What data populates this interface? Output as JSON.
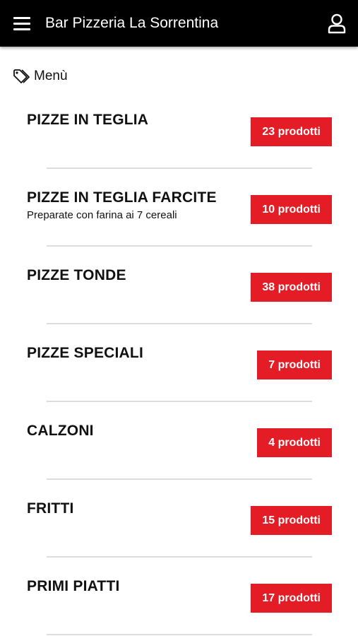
{
  "header": {
    "title": "Bar Pizzeria La Sorrentina",
    "menu_icon": "hamburger-menu-icon",
    "account_icon": "user-account-icon",
    "background": "#000000"
  },
  "section": {
    "icon": "tag-icon",
    "label": "Menù"
  },
  "accent_color": "#e31c25",
  "categories": [
    {
      "name": "PIZZE IN TEGLIA",
      "subtitle": "",
      "count": "23 prodotti"
    },
    {
      "name": "PIZZE IN TEGLIA FARCITE",
      "subtitle": "Preparate con farina ai 7 cereali",
      "count": "10 prodotti"
    },
    {
      "name": "PIZZE TONDE",
      "subtitle": "",
      "count": "38 prodotti"
    },
    {
      "name": "PIZZE SPECIALI",
      "subtitle": "",
      "count": "7 prodotti"
    },
    {
      "name": "CALZONI",
      "subtitle": "",
      "count": "4 prodotti"
    },
    {
      "name": "FRITTI",
      "subtitle": "",
      "count": "15 prodotti"
    },
    {
      "name": "PRIMI PIATTI",
      "subtitle": "",
      "count": "17 prodotti"
    }
  ]
}
